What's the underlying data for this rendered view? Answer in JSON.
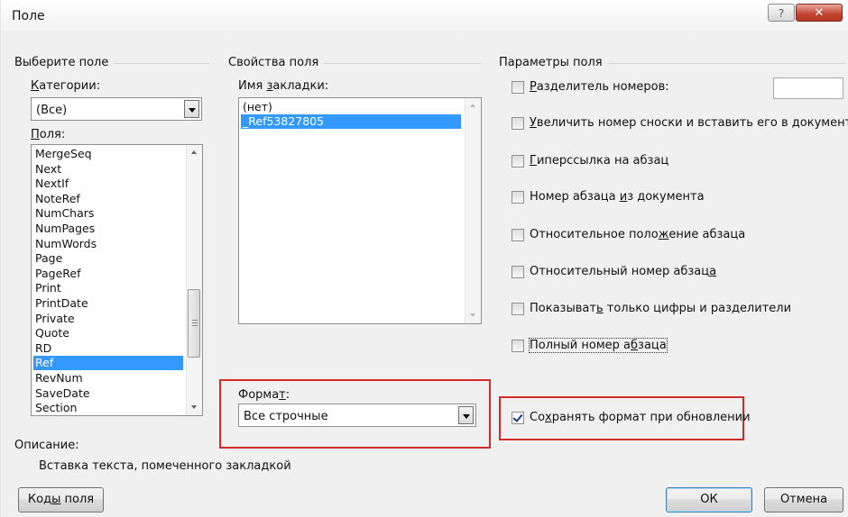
{
  "window": {
    "title": "Поле",
    "help_glyph": "?",
    "close_glyph": "✕"
  },
  "select_field": {
    "section_title": "Выберите поле",
    "categories_label": "Категории:",
    "categories_value": "(Все)",
    "fields_label": "Поля:",
    "fields": [
      "MergeSeq",
      "Next",
      "NextIf",
      "NoteRef",
      "NumChars",
      "NumPages",
      "NumWords",
      "Page",
      "PageRef",
      "Print",
      "PrintDate",
      "Private",
      "Quote",
      "RD",
      "Ref",
      "RevNum",
      "SaveDate",
      "Section"
    ],
    "selected_field": "Ref"
  },
  "field_properties": {
    "section_title": "Свойства поля",
    "bookmark_label": "Имя закладки:",
    "bookmarks": [
      "(нет)",
      "_Ref53827805"
    ],
    "selected_bookmark": "_Ref53827805",
    "format_label": "Формат:",
    "format_value": "Все строчные"
  },
  "field_options": {
    "section_title": "Параметры поля",
    "separator": {
      "label": "Разделитель номеров:",
      "checked": false,
      "value": ""
    },
    "options": [
      {
        "label": "Увеличить номер сноски и вставить его в документ",
        "checked": false
      },
      {
        "label": "Гиперссылка на абзац",
        "checked": false
      },
      {
        "label": "Номер абзаца из документа",
        "checked": false
      },
      {
        "label": "Относительное положение абзаца",
        "checked": false
      },
      {
        "label": "Относительный номер абзаца",
        "checked": false
      },
      {
        "label": "Показывать только цифры и разделители",
        "checked": false
      },
      {
        "label": "Полный номер абзаца",
        "checked": false
      }
    ],
    "preserve_format": {
      "label": "Сохранять формат при обновлении",
      "checked": true
    }
  },
  "description": {
    "label": "Описание:",
    "text": "Вставка текста, помеченного закладкой"
  },
  "buttons": {
    "field_codes": "Коды поля",
    "ok": "ОК",
    "cancel": "Отмена"
  },
  "colors": {
    "highlight": "#d32a2a",
    "selection": "#3399ff",
    "dialog_bg": "#f0f0f0"
  }
}
